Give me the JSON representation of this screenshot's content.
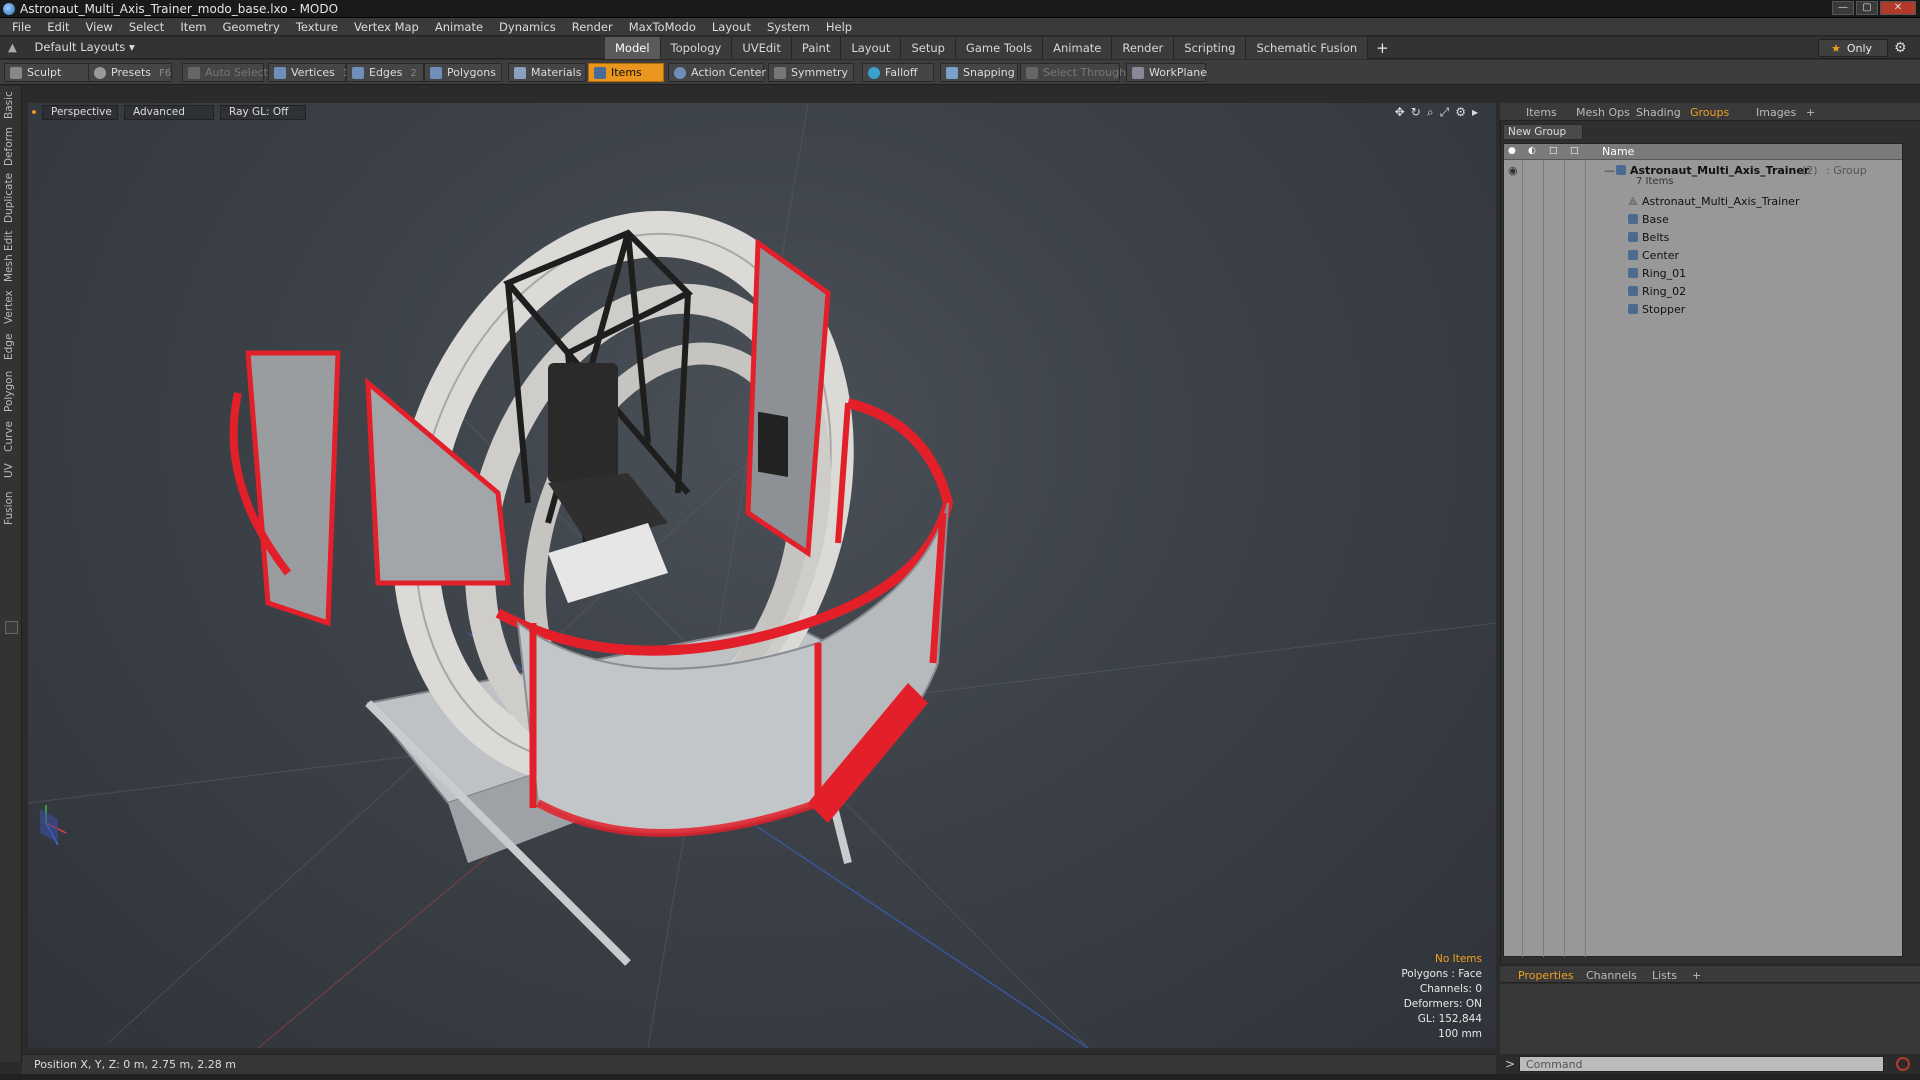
{
  "window": {
    "title": "Astronaut_Multi_Axis_Trainer_modo_base.lxo - MODO",
    "buttons": [
      "—",
      "▢",
      "✕"
    ]
  },
  "menu": [
    "File",
    "Edit",
    "View",
    "Select",
    "Item",
    "Geometry",
    "Texture",
    "Vertex Map",
    "Animate",
    "Dynamics",
    "Render",
    "MaxToModo",
    "Layout",
    "System",
    "Help"
  ],
  "layout_bar": {
    "selector": "Default Layouts",
    "tabs": [
      "Model",
      "Topology",
      "UVEdit",
      "Paint",
      "Layout",
      "Setup",
      "Game Tools",
      "Animate",
      "Render",
      "Scripting",
      "Schematic Fusion"
    ],
    "active_tab": "Model",
    "plus": "+",
    "only": "Only"
  },
  "toolbar": {
    "sculpt": "Sculpt",
    "presets": "Presets",
    "presets_key": "F6",
    "auto_select": "Auto Select",
    "vertices": "Vertices",
    "vertices_key": "1",
    "edges": "Edges",
    "edges_key": "2",
    "polygons": "Polygons",
    "materials": "Materials",
    "items": "Items",
    "action_center": "Action Center",
    "symmetry": "Symmetry",
    "falloff": "Falloff",
    "snapping": "Snapping",
    "select_through": "Select Through",
    "workplane": "WorkPlane",
    "accent": "#e8961e"
  },
  "left_tabs": [
    "Basic",
    "Deform",
    "Duplicate",
    "Mesh Edit",
    "Vertex",
    "Edge",
    "Polygon",
    "Curve",
    "UV",
    "Fusion"
  ],
  "viewport": {
    "view": "Perspective",
    "mode": "Advanced",
    "raygl": "Ray GL: Off",
    "info": {
      "no_items": "No Items",
      "polygons": "Polygons : Face",
      "channels": "Channels: 0",
      "deformers": "Deformers: ON",
      "gl": "GL: 152,844",
      "scale": "100 mm"
    }
  },
  "status": {
    "position": "Position X, Y, Z:  0 m, 2.75 m, 2.28 m"
  },
  "right_panel": {
    "tabs": [
      "Items",
      "Mesh Ops",
      "Shading",
      "Groups",
      "Images",
      "+"
    ],
    "active_tab": "Groups",
    "new_group": "New Group",
    "column_name": "Name",
    "group": {
      "name": "Astronaut_Multi_Axis_Trainer",
      "count": "(2)",
      "type": ": Group",
      "subtitle": "7 Items"
    },
    "children": [
      "Astronaut_Multi_Axis_Trainer",
      "Base",
      "Belts",
      "Center",
      "Ring_01",
      "Ring_02",
      "Stopper"
    ]
  },
  "properties_panel": {
    "tabs": [
      "Properties",
      "Channels",
      "Lists",
      "+"
    ],
    "active_tab": "Properties",
    "command_placeholder": "Command"
  }
}
